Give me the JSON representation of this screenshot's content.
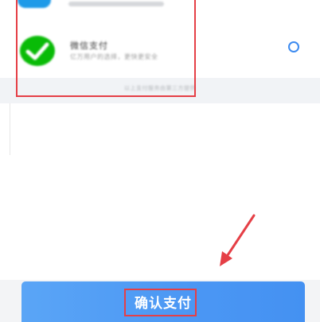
{
  "payment_options": [
    {
      "id": "alipay",
      "icon": "alipay-icon",
      "icon_color": "#1E9AE8"
    },
    {
      "id": "wechat",
      "title": "微信支付",
      "description": "亿万用户的选择，更快更安全",
      "icon": "wechat-pay-icon",
      "icon_color": "#09BB07",
      "selected": false
    }
  ],
  "notice": "以上支付服务由第三方提供",
  "confirm_button": {
    "label": "确认支付",
    "color": "#4A96F4"
  },
  "annotations": {
    "highlight_color": "#E53F46",
    "arrow_color": "#E53F46"
  }
}
